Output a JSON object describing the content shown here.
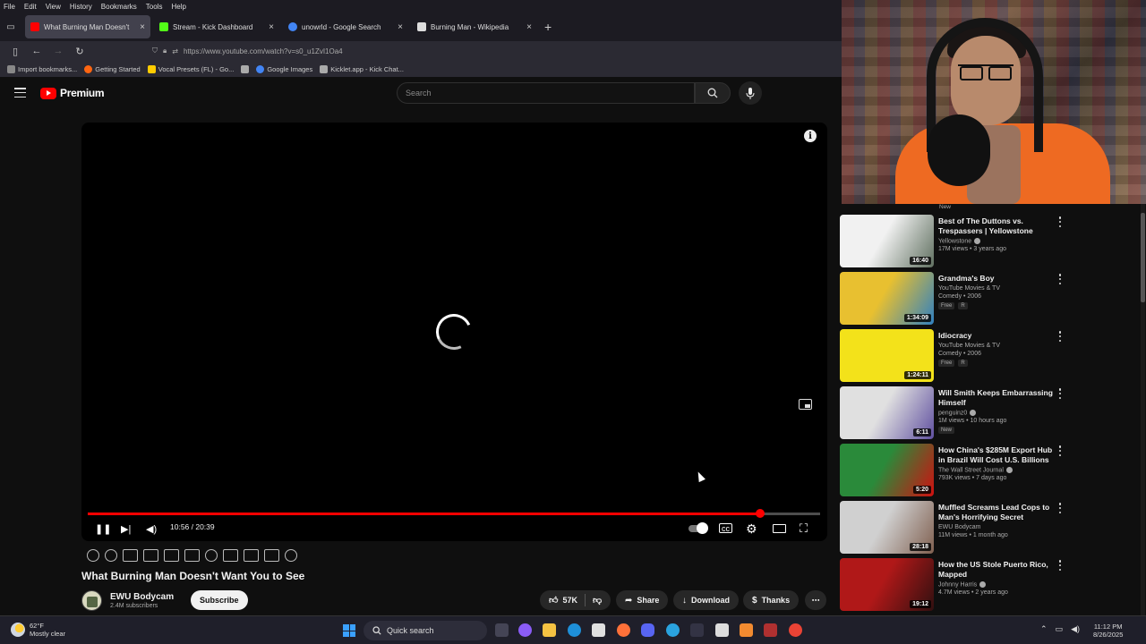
{
  "browser": {
    "menu": [
      "File",
      "Edit",
      "View",
      "History",
      "Bookmarks",
      "Tools",
      "Help"
    ],
    "tabs": [
      {
        "label": "What Burning Man Doesn't",
        "color": "#ff0000",
        "active": true
      },
      {
        "label": "Stream - Kick Dashboard",
        "color": "#53fc18",
        "active": false
      },
      {
        "label": "unowrld - Google Search",
        "color": "#4285f4",
        "active": false
      },
      {
        "label": "Burning Man - Wikipedia",
        "color": "#dddddd",
        "active": false
      }
    ],
    "url": "https://www.youtube.com/watch?v=s0_u1ZvI1Oa4",
    "bookmarks": [
      {
        "label": "Import bookmarks...",
        "color": "#888888"
      },
      {
        "label": "Getting Started",
        "color": "#ff6611"
      },
      {
        "label": "Vocal Presets (FL) - Go...",
        "color": "#ffcc00"
      },
      {
        "label": "",
        "color": "#aaaaaa"
      },
      {
        "label": "Google Images",
        "color": "#4285f4"
      },
      {
        "label": "Kicklet.app - Kick Chat...",
        "color": "#aaaaaa"
      }
    ]
  },
  "youtube": {
    "brand": "Premium",
    "search_placeholder": "Search",
    "player": {
      "current_time": "10:56",
      "duration": "20:39",
      "time_text": "10:56 / 20:39",
      "progress": 0.918
    },
    "video": {
      "title": "What Burning Man Doesn't Want You to See",
      "channel": "EWU Bodycam",
      "subscribers": "2.4M subscribers",
      "subscribe_label": "Subscribe",
      "likes": "57K",
      "share_label": "Share",
      "download_label": "Download",
      "thanks_label": "Thanks"
    },
    "sidebar_top": "New",
    "recommendations": [
      {
        "title": "Best of The Duttons vs. Trespassers | Yellowstone",
        "channel": "Yellowstone",
        "verified": true,
        "line": "17M views • 3 years ago",
        "duration": "16:40",
        "badges": [],
        "thumb": [
          "#f1f1f1",
          "#607060"
        ]
      },
      {
        "title": "Grandma's Boy",
        "channel": "YouTube Movies & TV",
        "verified": false,
        "line": "Comedy • 2006",
        "duration": "1:34:09",
        "badges": [
          "Free",
          "R"
        ],
        "thumb": [
          "#e8c030",
          "#3080c0"
        ]
      },
      {
        "title": "Idiocracy",
        "channel": "YouTube Movies & TV",
        "verified": false,
        "line": "Comedy • 2006",
        "duration": "1:24:11",
        "badges": [
          "Free",
          "R"
        ],
        "thumb": [
          "#f3e21a",
          "#f3e21a"
        ]
      },
      {
        "title": "Will Smith Keeps Embarrassing Himself",
        "channel": "penguinz0",
        "verified": true,
        "line": "1M views • 10 hours ago",
        "duration": "6:11",
        "badges": [
          "New"
        ],
        "thumb": [
          "#e0e0e0",
          "#6050a0"
        ]
      },
      {
        "title": "How China's $285M Export Hub in Brazil Will Cost U.S. Billions ...",
        "channel": "The Wall Street Journal",
        "verified": true,
        "line": "793K views • 7 days ago",
        "duration": "5:20",
        "badges": [],
        "thumb": [
          "#2a8a3a",
          "#d01010"
        ]
      },
      {
        "title": "Muffled Screams Lead Cops to Man's Horrifying Secret",
        "channel": "EWU Bodycam",
        "verified": false,
        "line": "11M views • 1 month ago",
        "duration": "28:18",
        "badges": [],
        "thumb": [
          "#d0d0d0",
          "#806050"
        ]
      },
      {
        "title": "How the US Stole Puerto Rico, Mapped",
        "channel": "Johnny Harris",
        "verified": true,
        "line": "4.7M views • 2 years ago",
        "duration": "19:12",
        "badges": [],
        "thumb": [
          "#b01818",
          "#301010"
        ]
      }
    ]
  },
  "taskbar": {
    "temp": "62°F",
    "weather": "Mostly clear",
    "search_label": "Quick search",
    "time": "11:12 PM",
    "date": "8/26/2025"
  }
}
